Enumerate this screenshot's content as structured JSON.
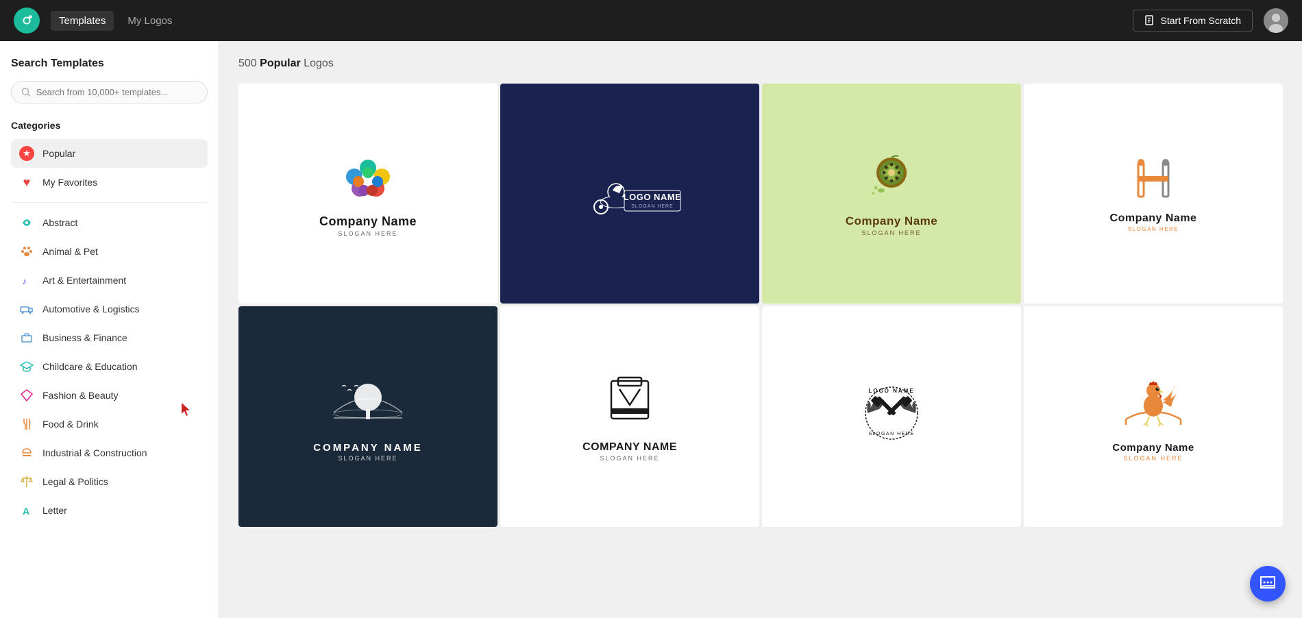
{
  "header": {
    "nav_templates": "Templates",
    "nav_mylogos": "My Logos",
    "start_scratch_label": "Start From Scratch"
  },
  "sidebar": {
    "title": "Search Templates",
    "search_placeholder": "Search from 10,000+ templates...",
    "categories_title": "Categories",
    "items": [
      {
        "id": "popular",
        "label": "Popular",
        "icon": "star",
        "active": true
      },
      {
        "id": "favorites",
        "label": "My Favorites",
        "icon": "heart",
        "active": false
      },
      {
        "id": "abstract",
        "label": "Abstract",
        "icon": "spiral",
        "active": false
      },
      {
        "id": "animal-pet",
        "label": "Animal & Pet",
        "icon": "paw",
        "active": false
      },
      {
        "id": "art-entertainment",
        "label": "Art & Entertainment",
        "icon": "music",
        "active": false
      },
      {
        "id": "automotive",
        "label": "Automotive & Logistics",
        "icon": "truck",
        "active": false
      },
      {
        "id": "business-finance",
        "label": "Business & Finance",
        "icon": "briefcase",
        "active": false
      },
      {
        "id": "childcare",
        "label": "Childcare & Education",
        "icon": "graduation",
        "active": false
      },
      {
        "id": "fashion",
        "label": "Fashion & Beauty",
        "icon": "diamond",
        "active": false
      },
      {
        "id": "food-drink",
        "label": "Food & Drink",
        "icon": "food",
        "active": false
      },
      {
        "id": "industrial",
        "label": "Industrial & Construction",
        "icon": "hard-hat",
        "active": false
      },
      {
        "id": "legal",
        "label": "Legal & Politics",
        "icon": "scale",
        "active": false
      },
      {
        "id": "letter",
        "label": "Letter",
        "icon": "letter-a",
        "active": false
      }
    ]
  },
  "content": {
    "count": "500",
    "category": "Popular",
    "suffix": "Logos"
  },
  "logos": [
    {
      "id": 1,
      "bg": "white",
      "type": "circles",
      "name": "Company Name",
      "slogan": "Slogan Here"
    },
    {
      "id": 2,
      "bg": "dark-blue",
      "type": "biker",
      "name": "Logo Name",
      "slogan": "Slogan Here"
    },
    {
      "id": 3,
      "bg": "light-green",
      "type": "kiwi",
      "name": "Company Name",
      "slogan": "Slogan Here"
    },
    {
      "id": 4,
      "bg": "white",
      "type": "infinity",
      "name": "Company Name",
      "slogan": "Slogan Here"
    },
    {
      "id": 5,
      "bg": "dark",
      "type": "tree",
      "name": "Company Name",
      "slogan": "Slogan Here"
    },
    {
      "id": 6,
      "bg": "white",
      "type": "karate",
      "name": "Company Name",
      "slogan": "Slogan Here"
    },
    {
      "id": 7,
      "bg": "white",
      "type": "hammers",
      "name": "Logo Name",
      "slogan": "Slogan Here"
    },
    {
      "id": 8,
      "bg": "white",
      "type": "rooster",
      "name": "Company Name",
      "slogan": "Slogan Here"
    }
  ]
}
